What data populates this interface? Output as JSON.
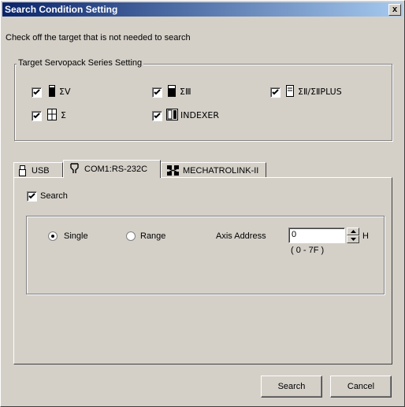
{
  "window": {
    "title": "Search Condition Setting",
    "close_label": "x"
  },
  "instruction": "Check off the target that is not needed to search",
  "series_group": {
    "title": "Target Servopack Series Setting",
    "items": [
      {
        "label": "ΣV",
        "checked": true
      },
      {
        "label": "ΣⅢ",
        "checked": true
      },
      {
        "label": "ΣⅡ/ΣⅡPLUS",
        "checked": true
      },
      {
        "label": "Σ",
        "checked": true
      },
      {
        "label": "INDEXER",
        "checked": true
      }
    ]
  },
  "tabs": [
    {
      "label": "USB",
      "icon": "usb-icon"
    },
    {
      "label": "COM1:RS-232C",
      "icon": "serial-connector-icon",
      "active": true
    },
    {
      "label": "MECHATROLINK-II",
      "icon": "network-icon"
    }
  ],
  "search_checkbox": {
    "label": "Search",
    "checked": true
  },
  "mode": {
    "single_label": "Single",
    "range_label": "Range",
    "selected": "Single"
  },
  "axis": {
    "label": "Axis Address",
    "value": "0",
    "unit": "H",
    "range_hint": "( 0 - 7F )"
  },
  "buttons": {
    "search": "Search",
    "cancel": "Cancel"
  }
}
